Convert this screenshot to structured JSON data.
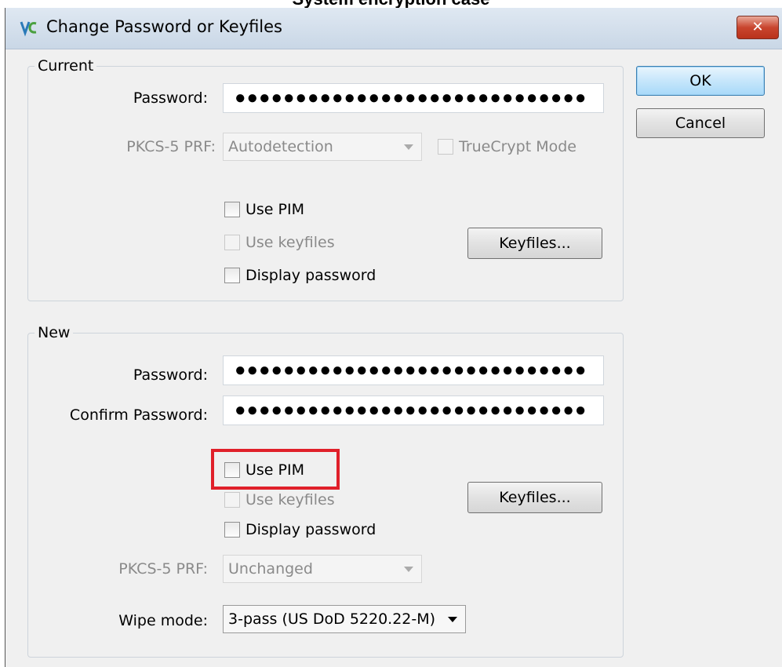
{
  "caption": "System encryption case",
  "window": {
    "title": "Change Password or Keyfiles",
    "close_label": "✕"
  },
  "buttons": {
    "ok": "OK",
    "cancel": "Cancel"
  },
  "current": {
    "group_title": "Current",
    "password_label": "Password:",
    "password_value": "●●●●●●●●●●●●●●●●●●●●●●●●●●●●●",
    "prf_label": "PKCS-5 PRF:",
    "prf_value": "Autodetection",
    "truecrypt_label": "TrueCrypt Mode",
    "use_pim_label": "Use PIM",
    "use_keyfiles_label": "Use keyfiles",
    "keyfiles_button": "Keyfiles...",
    "display_password_label": "Display password"
  },
  "new": {
    "group_title": "New",
    "password_label": "Password:",
    "password_value": "●●●●●●●●●●●●●●●●●●●●●●●●●●●●●",
    "confirm_label": "Confirm Password:",
    "confirm_value": "●●●●●●●●●●●●●●●●●●●●●●●●●●●●●",
    "use_pim_label": "Use PIM",
    "use_keyfiles_label": "Use keyfiles",
    "keyfiles_button": "Keyfiles...",
    "display_password_label": "Display password",
    "prf_label": "PKCS-5 PRF:",
    "prf_value": "Unchanged",
    "wipe_label": "Wipe mode:",
    "wipe_value": "3-pass (US DoD 5220.22-M)"
  },
  "colors": {
    "highlight": "#e0202a"
  }
}
